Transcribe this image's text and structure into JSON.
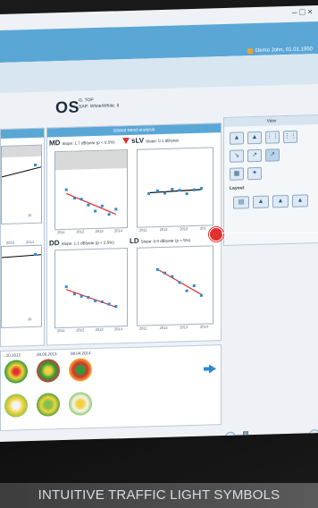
{
  "window": {
    "controls": "– □ ×"
  },
  "patient": {
    "name": "Demo John, 01.01.1950"
  },
  "eye": {
    "label": "OS",
    "test": "G, TOP",
    "type": "SAP: White/White, II"
  },
  "panels": {
    "global_trend": "Global trend analysis",
    "view": "View",
    "layout": "Layout"
  },
  "trend_charts": {
    "md": {
      "code": "MD",
      "stat": "Slope: 1.7 dB/year (p < 0.5%)",
      "flag": "red",
      "values": [
        [
          2010.4,
          2.1
        ],
        [
          2011,
          1.4
        ],
        [
          2011.5,
          1.3
        ],
        [
          2012,
          0.8
        ],
        [
          2012.5,
          0.3
        ],
        [
          2013,
          0.7
        ],
        [
          2013.5,
          0.0
        ],
        [
          2014,
          0.4
        ]
      ],
      "ticks": [
        "2011",
        "2012",
        "2013",
        "2014"
      ]
    },
    "slv": {
      "code": "sLV",
      "stat": "Slope: 0.1 dB/year",
      "flag": "none",
      "values": [
        [
          2010.4,
          1.6
        ],
        [
          2011,
          1.8
        ],
        [
          2011.5,
          1.6
        ],
        [
          2012,
          1.9
        ],
        [
          2012.5,
          1.8
        ],
        [
          2013,
          1.5
        ],
        [
          2013.5,
          1.8
        ],
        [
          2014,
          1.9
        ]
      ],
      "ticks": [
        "2011",
        "2012",
        "2013",
        "201"
      ]
    },
    "dd": {
      "code": "DD",
      "stat": "Slope: 1.1 dB/year (p < 0.5%)",
      "flag": "red",
      "values": [
        [
          2010.4,
          2.2
        ],
        [
          2011,
          1.6
        ],
        [
          2011.5,
          1.4
        ],
        [
          2012,
          1.3
        ],
        [
          2012.5,
          1.0
        ],
        [
          2013,
          0.9
        ],
        [
          2013.5,
          0.7
        ],
        [
          2014,
          0.5
        ]
      ],
      "ticks": [
        "2011",
        "2012",
        "2013",
        "2014"
      ]
    },
    "ld": {
      "code": "LD",
      "stat": "Slope: 0.9 dB/year (p < 5%)",
      "flag": "red",
      "values": [
        [
          2011,
          3.4
        ],
        [
          2011.5,
          3.1
        ],
        [
          2012,
          2.8
        ],
        [
          2012.5,
          2.3
        ],
        [
          2013,
          1.6
        ],
        [
          2013.5,
          2.0
        ],
        [
          2014,
          1.2
        ]
      ],
      "ticks": [
        "2011",
        "2012",
        "2013",
        "2014"
      ]
    }
  },
  "left_axis": {
    "top_tick": "15",
    "bottom_tick": "15",
    "labels": [
      "2013",
      "2014"
    ]
  },
  "visits": [
    "...10.2012",
    "28.05.2013",
    "08.04.2014"
  ],
  "caption": "INTUITIVE TRAFFIC LIGHT SYMBOLS"
}
